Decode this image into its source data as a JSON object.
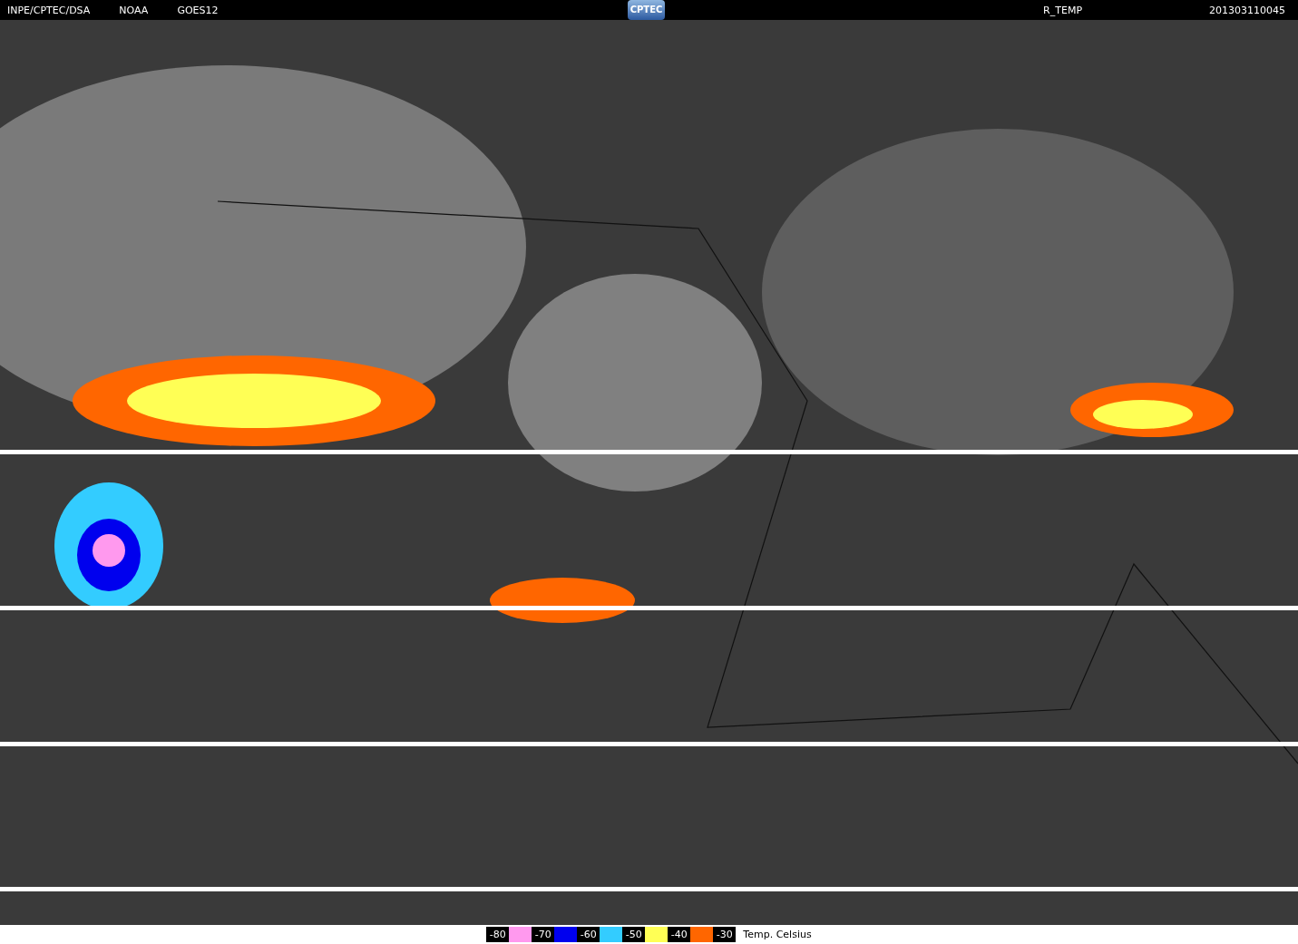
{
  "header": {
    "left": [
      "INPE/CPTEC/DSA",
      "NOAA",
      "GOES12"
    ],
    "logo": "CPTEC",
    "product": "R_TEMP",
    "timestamp": "201303110045"
  },
  "legend": {
    "scale_labels": [
      "-80",
      "-70",
      "-60",
      "-50",
      "-40",
      "-30"
    ],
    "swatches": [
      {
        "color": "#ff99ee"
      },
      {
        "color": "#0000ee"
      },
      {
        "color": "#33ccff"
      },
      {
        "color": "#ffff55"
      },
      {
        "color": "#ff6600"
      }
    ],
    "unit": "Temp. Celsius"
  }
}
